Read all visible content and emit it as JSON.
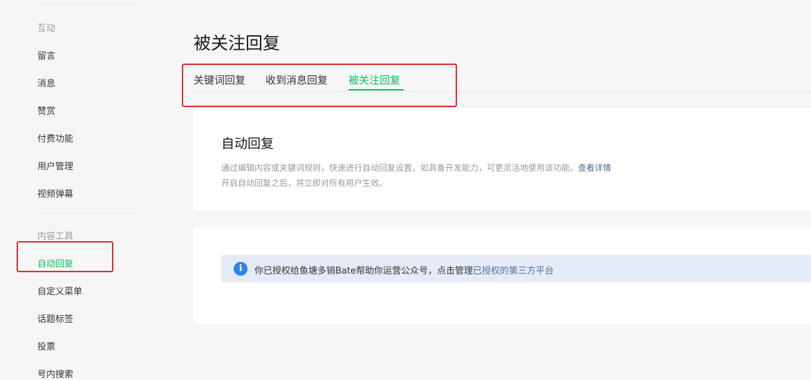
{
  "sidebar": {
    "group_interact": "互动",
    "items_interact": [
      "留言",
      "消息",
      "赞赏",
      "付费功能",
      "用户管理",
      "视频弹幕"
    ],
    "group_content": "内容工具",
    "items_content": [
      "自动回复",
      "自定义菜单",
      "话题标签",
      "投票",
      "号内搜索"
    ],
    "active_item": "自动回复"
  },
  "header": {
    "title": "被关注回复"
  },
  "tabs": {
    "keyword": "关键词回复",
    "message": "收到消息回复",
    "follow": "被关注回复",
    "active": "被关注回复"
  },
  "auto_reply_card": {
    "title": "自动回复",
    "desc_line1": "通过编辑内容或关键词规则，快速进行自动回复设置。如具备开发能力，可更灵活地使用该功能。",
    "desc_link": "查看详情",
    "desc_line2": "开启自动回复之后，将立即对所有用户生效。"
  },
  "notice": {
    "icon": "info-icon",
    "text": "你已授权给鱼塘多销Bate帮助你运营公众号，点击管理",
    "link": "已授权的第三方平台"
  },
  "colors": {
    "accent": "#07c160",
    "highlight": "#e02a2a",
    "link": "#576b95",
    "info": "#2e82f0"
  }
}
